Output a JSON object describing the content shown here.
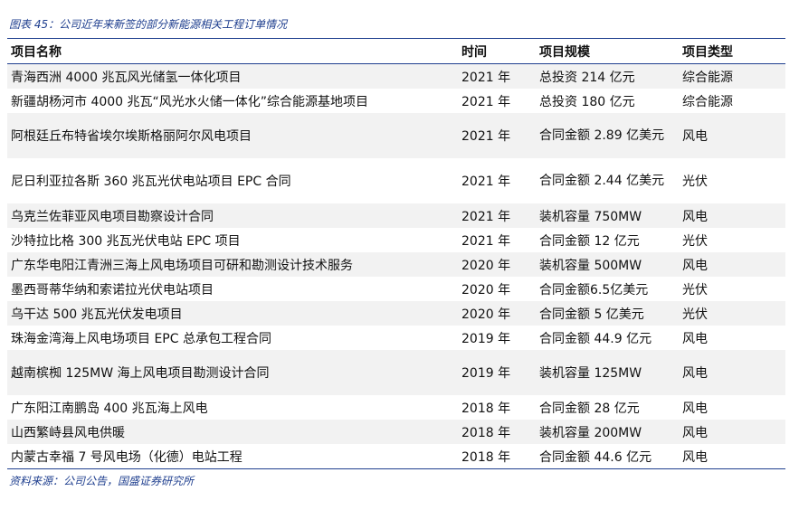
{
  "caption": "图表 45：公司近年来新签的部分新能源相关工程订单情况",
  "headers": [
    "项目名称",
    "时间",
    "项目规模",
    "项目类型"
  ],
  "rows": [
    {
      "name": "青海西洲 4000 兆瓦风光储氢一体化项目",
      "time": "2021 年",
      "scale": "总投资 214 亿元",
      "type": "综合能源"
    },
    {
      "name": "新疆胡杨河市 4000 兆瓦“风光水火储一体化”综合能源基地项目",
      "time": "2021 年",
      "scale": "总投资 180 亿元",
      "type": "综合能源"
    },
    {
      "name": "阿根廷丘布特省埃尔埃斯格丽阿尔风电项目",
      "time": "2021 年",
      "scale": "合同金额 2.89 亿美元",
      "type": "风电"
    },
    {
      "name": "尼日利亚拉各斯 360 兆瓦光伏电站项目 EPC 合同",
      "time": "2021 年",
      "scale": "合同金额 2.44 亿美元",
      "type": "光伏"
    },
    {
      "name": "乌克兰佐菲亚风电项目勘察设计合同",
      "time": "2021 年",
      "scale": "装机容量 750MW",
      "type": "风电"
    },
    {
      "name": "沙特拉比格 300 兆瓦光伏电站 EPC 项目",
      "time": "2021 年",
      "scale": "合同金额 12 亿元",
      "type": "光伏"
    },
    {
      "name": "广东华电阳江青洲三海上风电场项目可研和勘测设计技术服务",
      "time": "2020 年",
      "scale": "装机容量 500MW",
      "type": "风电"
    },
    {
      "name": "墨西哥蒂华纳和索诺拉光伏电站项目",
      "time": "2020 年",
      "scale": "合同金额6.5亿美元",
      "type": "光伏"
    },
    {
      "name": "乌干达 500 兆瓦光伏发电项目",
      "time": "2020 年",
      "scale": "合同金额 5 亿美元",
      "type": "光伏"
    },
    {
      "name": "珠海金湾海上风电场项目 EPC 总承包工程合同",
      "time": "2019 年",
      "scale": "合同金额 44.9 亿元",
      "type": "风电"
    },
    {
      "name": "越南槟椥 125MW 海上风电项目勘测设计合同",
      "time": "2019 年",
      "scale": "装机容量 125MW",
      "type": "风电"
    },
    {
      "name": "广东阳江南鹏岛 400 兆瓦海上风电",
      "time": "2018 年",
      "scale": "合同金额 28 亿元",
      "type": "风电"
    },
    {
      "name": "山西繁峙县风电供暖",
      "time": "2018 年",
      "scale": "装机容量 200MW",
      "type": "风电"
    },
    {
      "name": "内蒙古幸福 7 号风电场（化德）电站工程",
      "time": "2018 年",
      "scale": "合同金额 44.6 亿元",
      "type": "风电"
    }
  ],
  "source": "资料来源：公司公告，国盛证券研究所"
}
